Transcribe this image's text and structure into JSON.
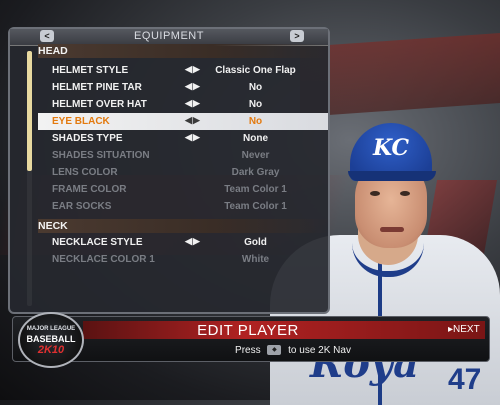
{
  "panel": {
    "title": "EQUIPMENT",
    "prev_icon": "<",
    "next_icon": ">"
  },
  "sections": {
    "head": "HEAD",
    "neck": "NECK"
  },
  "rows": [
    {
      "label": "HELMET STYLE",
      "value": "Classic One Flap",
      "state": "enabled"
    },
    {
      "label": "HELMET PINE TAR",
      "value": "No",
      "state": "enabled"
    },
    {
      "label": "HELMET OVER HAT",
      "value": "No",
      "state": "enabled"
    },
    {
      "label": "EYE BLACK",
      "value": "No",
      "state": "selected"
    },
    {
      "label": "SHADES TYPE",
      "value": "None",
      "state": "enabled"
    },
    {
      "label": "SHADES SITUATION",
      "value": "Never",
      "state": "disabled"
    },
    {
      "label": "LENS COLOR",
      "value": "Dark Gray",
      "state": "disabled"
    },
    {
      "label": "FRAME COLOR",
      "value": "Team Color 1",
      "state": "disabled"
    },
    {
      "label": "EAR SOCKS",
      "value": "Team Color 1",
      "state": "disabled"
    },
    {
      "label": "NECKLACE STYLE",
      "value": "Gold",
      "state": "enabled"
    },
    {
      "label": "NECKLACE COLOR 1",
      "value": "White",
      "state": "disabled"
    }
  ],
  "arrows_glyph": "◀▶",
  "bottom": {
    "title": "EDIT PLAYER",
    "next_label": "▸NEXT",
    "hint_prefix": "Press",
    "hint_suffix": "to use 2K Nav"
  },
  "logo": {
    "line1": "MAJOR LEAGUE",
    "line2": "BASEBALL",
    "line3": "2K10"
  },
  "player": {
    "cap_logo": "KC",
    "jersey_script": "Roya",
    "jersey_number": "47"
  },
  "colors": {
    "selected_text": "#e37a0f",
    "team_blue": "#1f3d8a",
    "accent_red": "#b02222"
  }
}
